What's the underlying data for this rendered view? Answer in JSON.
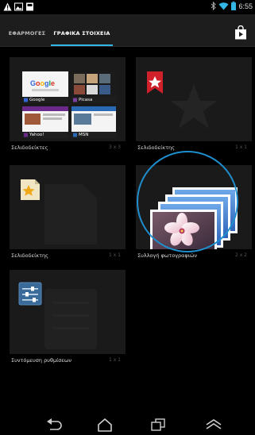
{
  "status_bar": {
    "time": "6:55"
  },
  "tabs": [
    {
      "label": "ΕΦΑΡΜΟΓΕΣ",
      "selected": false
    },
    {
      "label": "ΓΡΑΦΙΚΑ ΣΤΟΙΧΕΙΑ",
      "selected": true
    }
  ],
  "widgets": [
    {
      "label": "Σελιδοδείκτες",
      "size": "3 x 3",
      "thumbs": [
        "Google",
        "Picasa",
        "Yahoo!",
        "MSN"
      ]
    },
    {
      "label": "Σελιδοδείκτης",
      "size": "1 x 1"
    },
    {
      "label": "Σελιδοδείκτης",
      "size": "1 x 1"
    },
    {
      "label": "Συλλογή φωτογραφιών",
      "size": "2 x 2"
    },
    {
      "label": "Συντόμευση ρυθμίσεων",
      "size": "1 x 1"
    }
  ],
  "colors": {
    "accent": "#33b5e5",
    "highlight_ring": "#1f8fcf",
    "bookmark_red": "#d0202a"
  },
  "icons": [
    "warning-icon",
    "image-icon",
    "notification-icon",
    "bluetooth-icon",
    "wifi-icon",
    "battery-icon",
    "play-store-icon",
    "back-icon",
    "home-icon",
    "recent-apps-icon",
    "menu-icon"
  ]
}
